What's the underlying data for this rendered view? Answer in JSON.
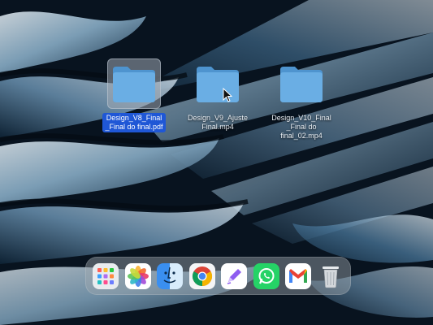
{
  "desktop": {
    "files": [
      {
        "name": "Design_V8_Final\n_Final do final.pdf",
        "selected": true,
        "type": "folder"
      },
      {
        "name": "Design_V9_Ajuste\nFinal.mp4",
        "selected": false,
        "type": "folder"
      },
      {
        "name": "Design_V10_Final\n_Final do final_02.mp4",
        "selected": false,
        "type": "folder"
      }
    ],
    "colors": {
      "folder_blue": "#6aaee4",
      "selection_blue": "#1f57d6",
      "wallpaper_dark": "#0a1624",
      "wallpaper_light": "#dfeaf2"
    }
  },
  "dock": {
    "apps": [
      {
        "name": "launchpad",
        "icon": "launchpad-icon"
      },
      {
        "name": "photos",
        "icon": "photos-icon"
      },
      {
        "name": "finder",
        "icon": "finder-icon"
      },
      {
        "name": "chrome",
        "icon": "chrome-icon"
      },
      {
        "name": "pencil app",
        "icon": "pencil-icon"
      },
      {
        "name": "whatsapp",
        "icon": "whatsapp-icon"
      },
      {
        "name": "gmail",
        "icon": "gmail-icon"
      },
      {
        "name": "trash",
        "icon": "trash-icon"
      }
    ]
  }
}
